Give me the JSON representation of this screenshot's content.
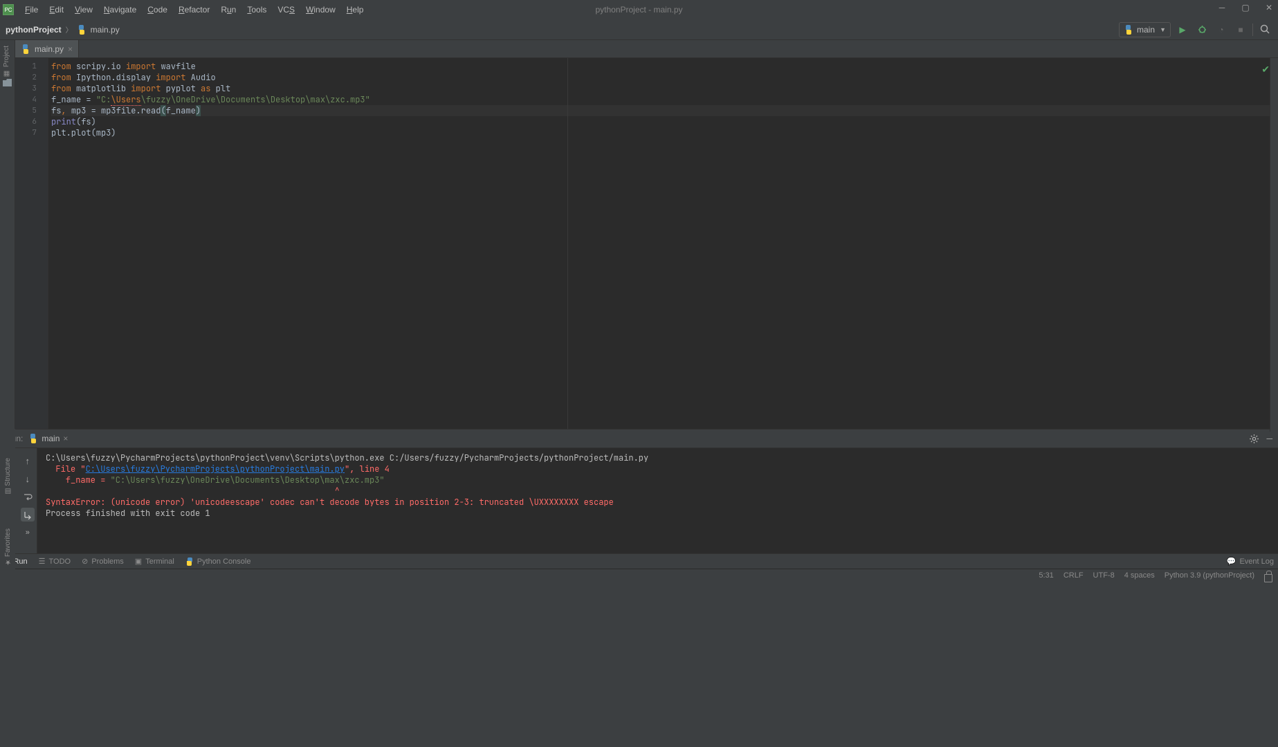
{
  "window": {
    "title": "pythonProject - main.py"
  },
  "menu": {
    "items": [
      "File",
      "Edit",
      "View",
      "Navigate",
      "Code",
      "Refactor",
      "Run",
      "Tools",
      "VCS",
      "Window",
      "Help"
    ]
  },
  "breadcrumb": {
    "project": "pythonProject",
    "file": "main.py"
  },
  "runConfig": {
    "name": "main"
  },
  "tab": {
    "name": "main.py"
  },
  "code": {
    "l1_from": "from",
    "l1_mod": "scripy.io",
    "l1_imp": "import",
    "l1_sym": "wavfile",
    "l2_from": "from",
    "l2_mod": "Ipython.display",
    "l2_imp": "import",
    "l2_sym": "Audio",
    "l3_from": "from",
    "l3_mod": "matplotlib",
    "l3_imp": "import",
    "l3_sym1": "pyplot",
    "l3_as": "as",
    "l3_sym2": "plt",
    "l4_var": "f_name",
    "l4_eq": " = ",
    "l4_q1": "\"C:",
    "l4_esc": "\\Users",
    "l4_rest": "\\fuzzy\\OneDrive\\Documents\\Desktop\\max\\zxc.mp3\"",
    "l5_a": "fs",
    "l5_c": ", ",
    "l5_b": "mp3",
    "l5_eq": " = mp3file.read",
    "l5_p1": "(",
    "l5_arg": "f_name",
    "l5_p2": ")",
    "l6_fn": "print",
    "l6_p": "(fs)",
    "l7": "plt.plot(mp3)"
  },
  "lineNumbers": [
    "1",
    "2",
    "3",
    "4",
    "5",
    "6",
    "7"
  ],
  "runPanel": {
    "label": "Run:",
    "tabName": "main",
    "output": {
      "l1": "C:\\Users\\fuzzy\\PycharmProjects\\pythonProject\\venv\\Scripts\\python.exe C:/Users/fuzzy/PycharmProjects/pythonProject/main.py",
      "l2_a": "  File \"",
      "l2_link": "C:\\Users\\fuzzy\\PycharmProjects\\pythonProject\\main.py",
      "l2_b": "\", line 4",
      "l3_a": "    f_name = ",
      "l3_str": "\"C:\\Users\\fuzzy\\OneDrive\\Documents\\Desktop\\max\\zxc.mp3\"",
      "l4": "                                                          ^",
      "l5": "SyntaxError: (unicode error) 'unicodeescape' codec can't decode bytes in position 2-3: truncated \\UXXXXXXXX escape",
      "l6": "",
      "l7": "Process finished with exit code 1"
    }
  },
  "leftTabs": {
    "project": "Project"
  },
  "leftLower": {
    "structure": "Structure",
    "favorites": "Favorites"
  },
  "bottomBar": {
    "run": "Run",
    "todo": "TODO",
    "problems": "Problems",
    "terminal": "Terminal",
    "pyconsole": "Python Console",
    "eventlog": "Event Log"
  },
  "status": {
    "pos": "5:31",
    "le": "CRLF",
    "enc": "UTF-8",
    "indent": "4 spaces",
    "interp": "Python 3.9 (pythonProject)"
  }
}
